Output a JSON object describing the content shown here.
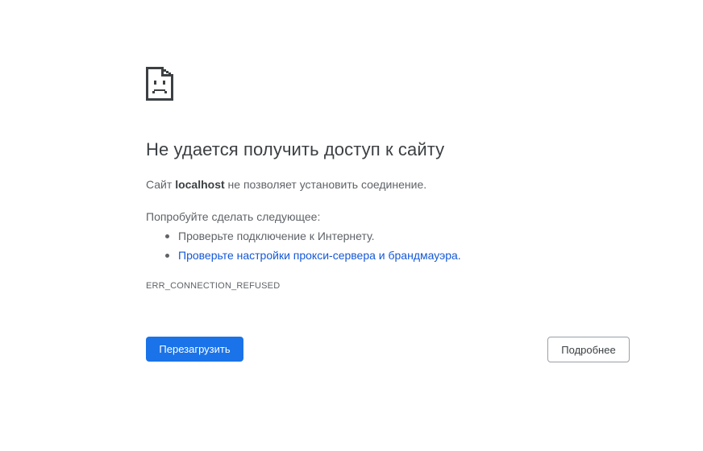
{
  "error": {
    "icon": "sad-document-icon",
    "title": "Не удается получить доступ к сайту",
    "summary_prefix": "Сайт ",
    "host": "localhost",
    "summary_suffix": " не позволяет установить соединение.",
    "suggestions_heading": "Попробуйте сделать следующее:",
    "suggestions": [
      "Проверьте подключение к Интернету.",
      "Проверьте настройки прокси-сервера и брандмауэра."
    ],
    "code": "ERR_CONNECTION_REFUSED"
  },
  "buttons": {
    "reload_label": "Перезагрузить",
    "details_label": "Подробнее"
  },
  "colors": {
    "accent": "#1a73e8",
    "link": "#1558d6",
    "title": "#3c4043",
    "text": "#5f6368"
  }
}
